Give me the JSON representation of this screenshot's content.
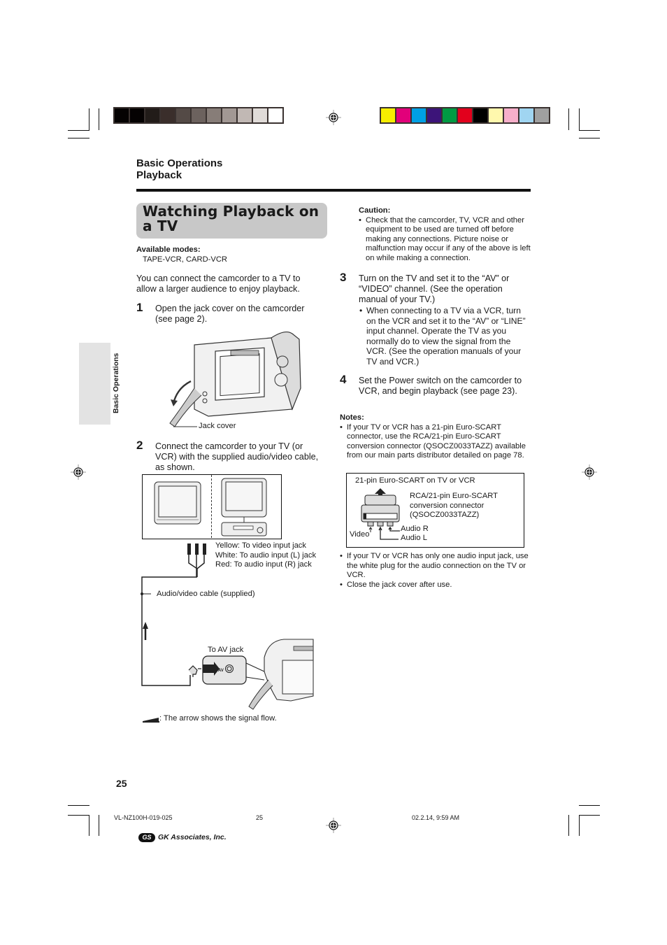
{
  "print_marks": {
    "grayscale_swatches": [
      "#050202",
      "#050202",
      "#221c19",
      "#3a2e2b",
      "#544a46",
      "#6c625e",
      "#877d78",
      "#a29894",
      "#c1b8b4",
      "#e0dbd8",
      "#ffffff"
    ],
    "color_swatches": [
      "#f7ee00",
      "#e2007a",
      "#00a0e4",
      "#3c1479",
      "#009a43",
      "#e2001c",
      "#000000",
      "#fff8ad",
      "#f6afca",
      "#a0d5f1",
      "#a0a0a0"
    ]
  },
  "header": {
    "section": "Basic Operations",
    "subsection": "Playback"
  },
  "side_tab": {
    "label": "Basic Operations"
  },
  "title": "Watching Playback on a TV",
  "available_modes": {
    "label": "Available modes:",
    "value": "TAPE-VCR, CARD-VCR"
  },
  "intro": "You can connect the camcorder to a TV to allow a larger audience to enjoy playback.",
  "steps": [
    {
      "number": "1",
      "text": "Open the jack cover on the camcorder (see page 2)."
    },
    {
      "number": "2",
      "text": "Connect the camcorder to your TV (or VCR) with the supplied audio/video cable, as shown."
    },
    {
      "number": "3",
      "text": "Turn on the TV and set it to the “AV” or “VIDEO” channel. (See the operation manual of your TV.)",
      "bullets": [
        "When connecting to a TV via a VCR, turn on the VCR and set it to the “AV” or “LINE” input channel. Operate the TV as you normally do to view the signal from the VCR. (See the operation manuals of your TV and VCR.)"
      ]
    },
    {
      "number": "4",
      "text": "Set the Power switch on the camcorder to VCR, and begin playback (see page 23)."
    }
  ],
  "figure1": {
    "jack_cover_label": "Jack cover"
  },
  "figure2": {
    "plug_labels": [
      "Yellow: To video input jack",
      "White: To audio input (L) jack",
      "Red: To audio input (R) jack"
    ],
    "cable_label": "Audio/video cable (supplied)",
    "av_jack_label": "To AV jack",
    "av_text": "AV",
    "signal_note": ": The arrow shows the signal flow."
  },
  "caution": {
    "label": "Caution:",
    "bullets": [
      "Check that the camcorder, TV, VCR and other equipment to be used are turned off before making any connections. Picture noise or malfunction may occur if any of the above is left on while making a connection."
    ]
  },
  "notes": {
    "label": "Notes:",
    "bullets": [
      "If your TV or VCR has a 21-pin Euro-SCART connector, use the RCA/21-pin Euro-SCART conversion connector (QSOCZ0033TAZZ) available from our main parts distributor detailed on page 78.",
      "If your TV or VCR has only one audio input jack, use the white plug for the audio connection on the TV or VCR.",
      "Close the jack cover after use."
    ],
    "scart_box": {
      "title": "21-pin Euro-SCART on TV or VCR",
      "connector_label_1": "RCA/21-pin Euro-SCART",
      "connector_label_2": "conversion connector",
      "connector_label_3": "(QSOCZ0033TAZZ)",
      "video": "Video",
      "audio_r": "Audio R",
      "audio_l": "Audio L"
    }
  },
  "page_number": "25",
  "footer": {
    "doc_code": "VL-NZ100H-019-025",
    "page": "25",
    "timestamp": "02.2.14, 9:59 AM",
    "publisher": "GK Associates, Inc.",
    "publisher_logo": "GS"
  }
}
